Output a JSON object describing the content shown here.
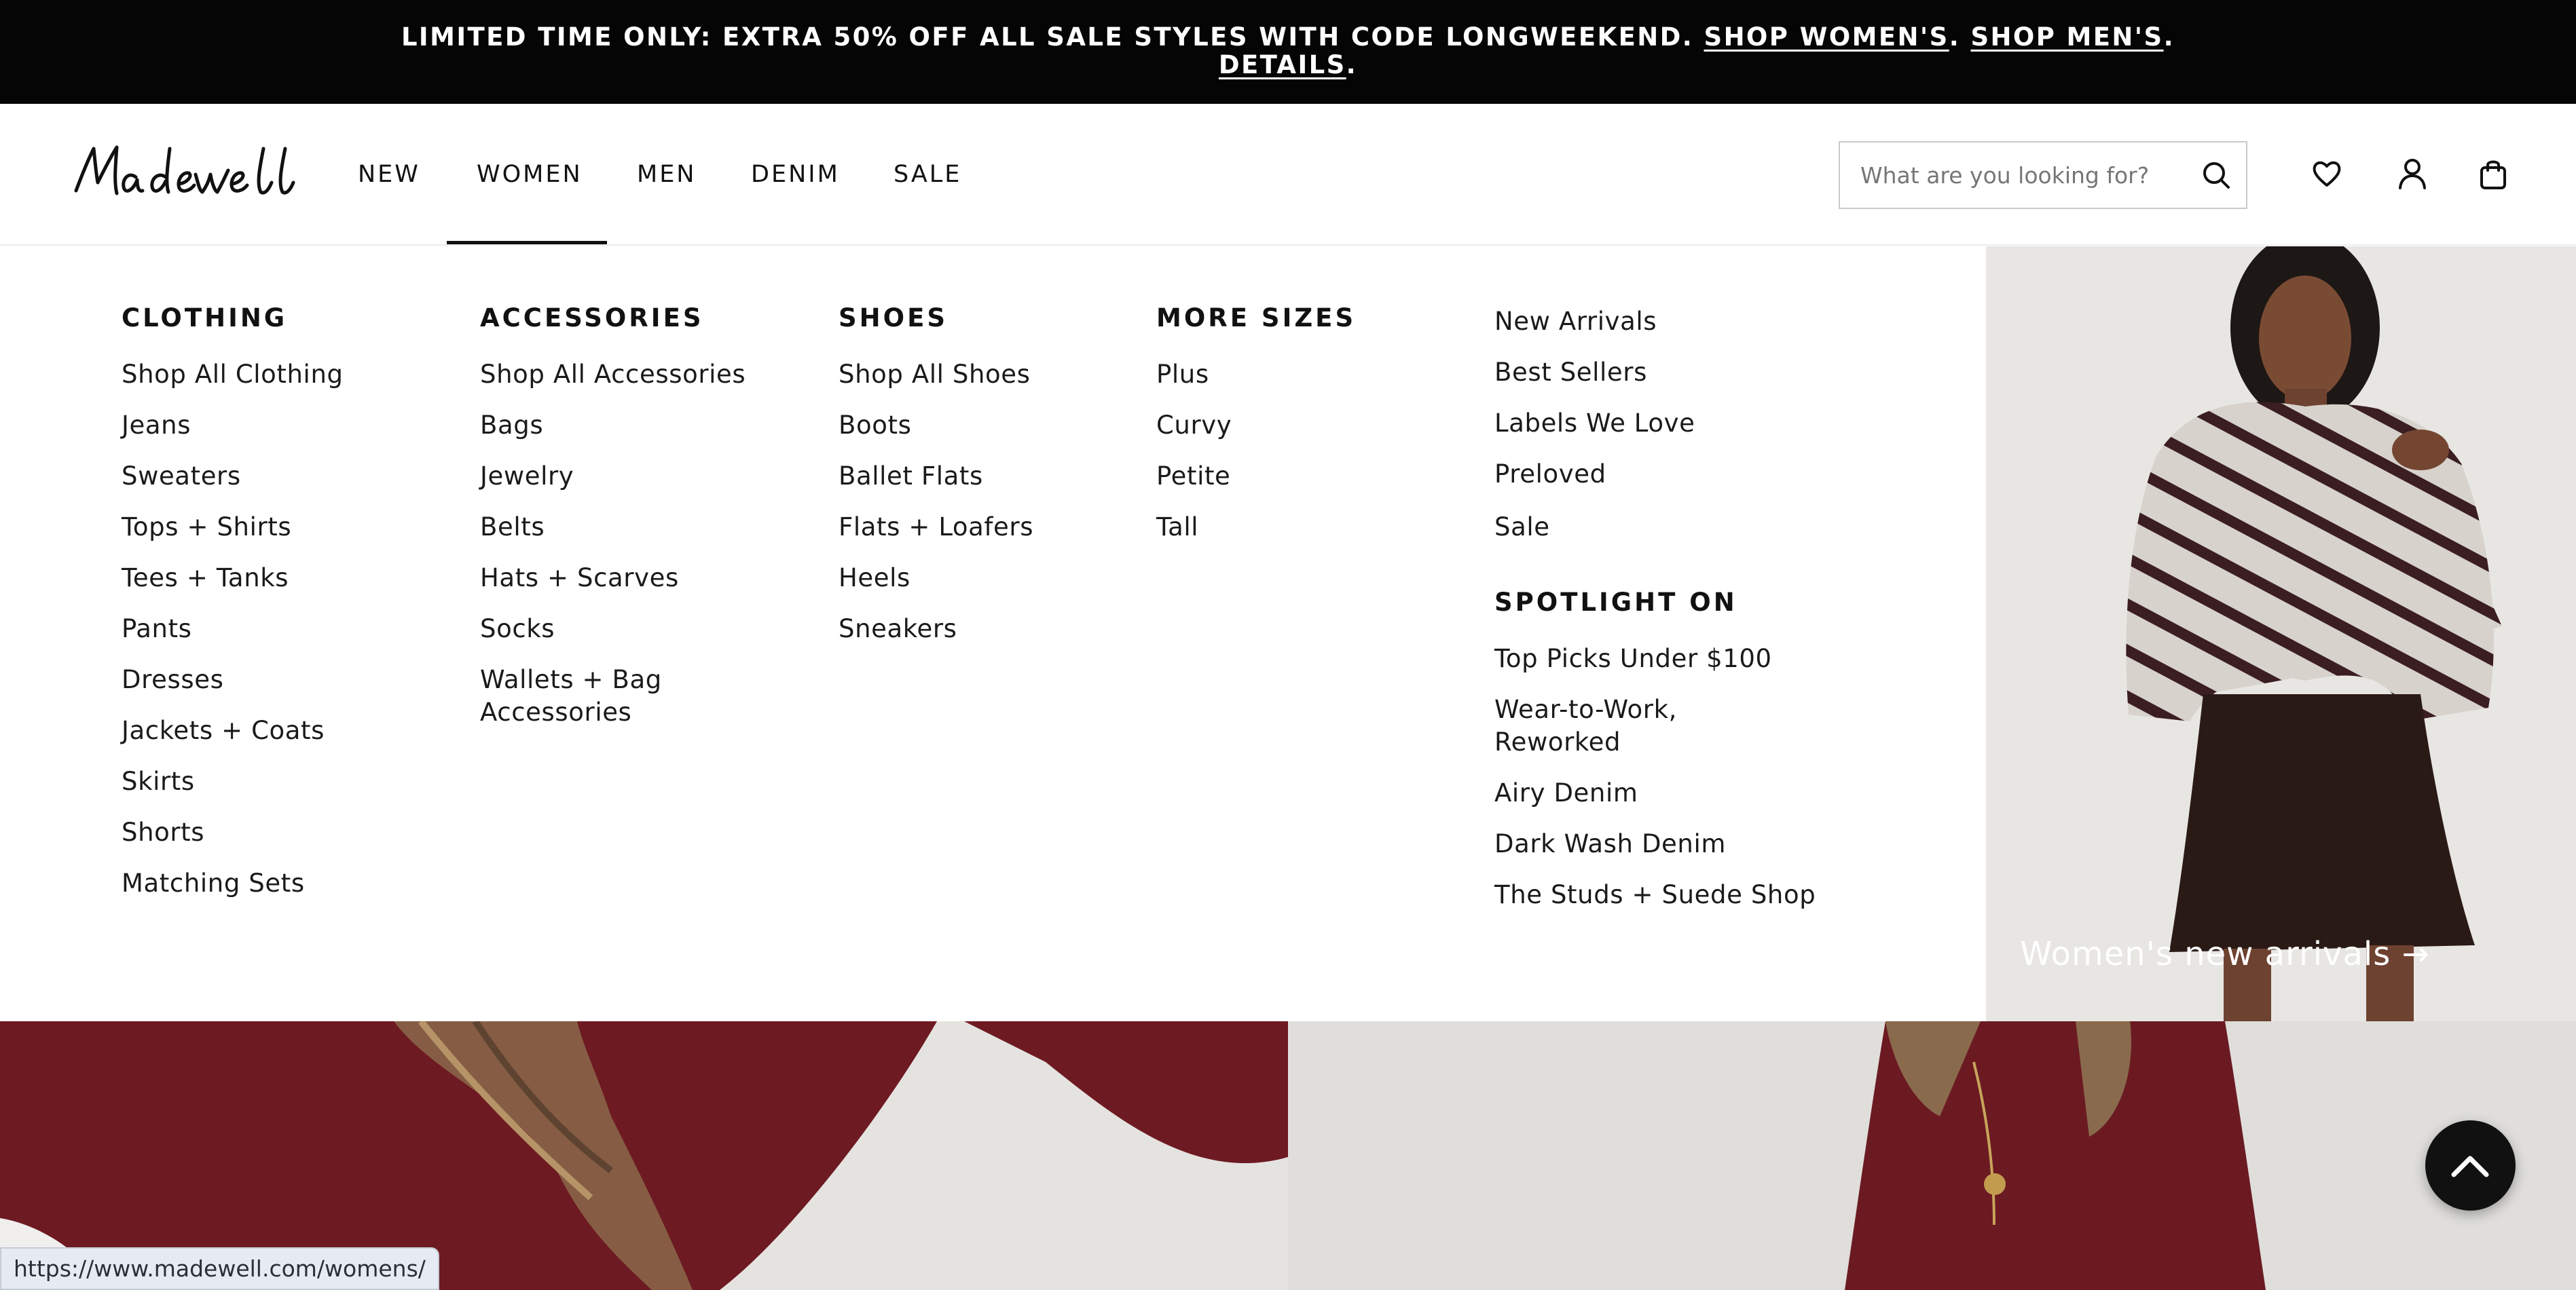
{
  "promo": {
    "text": "LIMITED TIME ONLY: EXTRA 50% OFF ALL SALE STYLES WITH CODE LONGWEEKEND.",
    "shop_womens": "SHOP WOMEN'S",
    "shop_mens": "SHOP MEN'S",
    "details": "DETAILS",
    "sep": "."
  },
  "header": {
    "logo_text": "Madewell",
    "nav": [
      "NEW",
      "WOMEN",
      "MEN",
      "DENIM",
      "SALE"
    ],
    "active_nav": "WOMEN",
    "search_placeholder": "What are you looking for?",
    "icons": [
      "search-icon",
      "heart-icon",
      "account-icon",
      "bag-icon"
    ]
  },
  "menu": {
    "clothing": {
      "heading": "CLOTHING",
      "items": [
        "Shop All Clothing",
        "Jeans",
        "Sweaters",
        "Tops + Shirts",
        "Tees + Tanks",
        "Pants",
        "Dresses",
        "Jackets + Coats",
        "Skirts",
        "Shorts",
        "Matching Sets"
      ]
    },
    "accessories": {
      "heading": "ACCESSORIES",
      "items": [
        "Shop All Accessories",
        "Bags",
        "Jewelry",
        "Belts",
        "Hats + Scarves",
        "Socks",
        "Wallets + Bag Accessories"
      ]
    },
    "shoes": {
      "heading": "SHOES",
      "items": [
        "Shop All Shoes",
        "Boots",
        "Ballet Flats",
        "Flats + Loafers",
        "Heels",
        "Sneakers"
      ]
    },
    "sizes": {
      "heading": "MORE SIZES",
      "items": [
        "Plus",
        "Curvy",
        "Petite",
        "Tall"
      ]
    },
    "featured": {
      "items": [
        "New Arrivals",
        "Best Sellers",
        "Labels We Love",
        "Preloved",
        "Sale"
      ]
    },
    "spotlight": {
      "heading": "SPOTLIGHT ON",
      "items": [
        "Top Picks Under $100",
        "Wear-to-Work, Reworked",
        "Airy Denim",
        "Dark Wash Denim",
        "The Studs + Suede Shop"
      ]
    }
  },
  "promo_panel": {
    "caption": "Women's new arrivals →"
  },
  "status_bar": {
    "url": "https://www.madewell.com/womens/"
  },
  "colors": {
    "banner_bg": "#050505",
    "text": "#1a1a1a",
    "sweater_red": "#6e1a22"
  }
}
